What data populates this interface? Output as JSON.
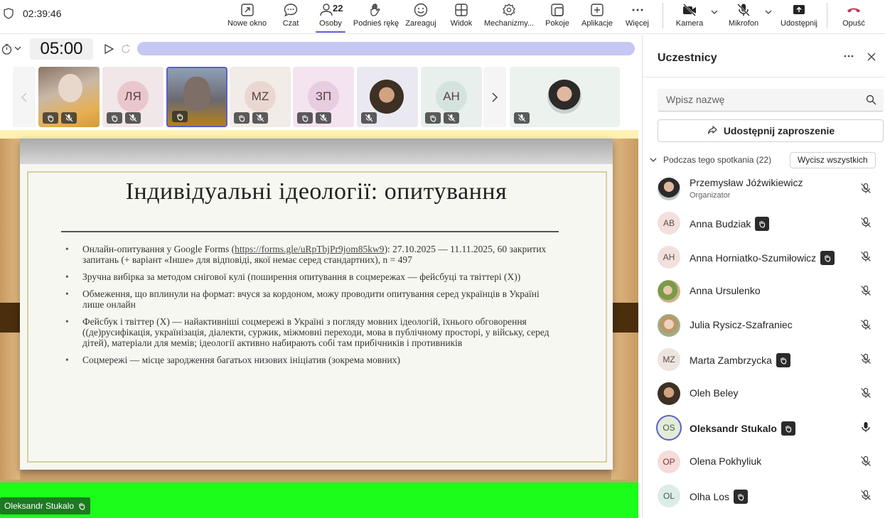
{
  "clock": "02:39:46",
  "toolbar": {
    "items": [
      {
        "label": "Nowe okno",
        "icon": "pop-out-icon"
      },
      {
        "label": "Czat",
        "icon": "chat-icon"
      },
      {
        "label": "Osoby",
        "icon": "people-icon",
        "count": "22"
      },
      {
        "label": "Podnieś rękę",
        "icon": "raise-hand-icon"
      },
      {
        "label": "Zareaguj",
        "icon": "react-icon"
      },
      {
        "label": "Widok",
        "icon": "view-icon"
      },
      {
        "label": "Mechanizmy...",
        "icon": "apps-gear-icon"
      },
      {
        "label": "Pokoje",
        "icon": "rooms-icon"
      },
      {
        "label": "Aplikacje",
        "icon": "add-app-icon"
      },
      {
        "label": "Więcej",
        "icon": "more-icon"
      },
      {
        "label": "Kamera",
        "icon": "camera-off-icon"
      },
      {
        "label": "Mikrofon",
        "icon": "mic-off-icon"
      },
      {
        "label": "Udostępnij",
        "icon": "share-icon"
      },
      {
        "label": "Opuść",
        "icon": "hang-up-icon"
      }
    ]
  },
  "timer": {
    "value": "05:00"
  },
  "strip": {
    "tiles": [
      {
        "initials": "",
        "type": "video"
      },
      {
        "initials": "ЛЯ",
        "type": "initials"
      },
      {
        "initials": "",
        "type": "video-selected"
      },
      {
        "initials": "MZ",
        "type": "initials"
      },
      {
        "initials": "ЗП",
        "type": "initials"
      },
      {
        "initials": "",
        "type": "photo"
      },
      {
        "initials": "AH",
        "type": "initials"
      },
      {
        "initials": "",
        "type": "photo-wide"
      }
    ]
  },
  "slide": {
    "title": "Індивідуальні ідеології: опитування",
    "bullets": [
      {
        "pre": "Онлайн-опитування у Google Forms (",
        "link": "https://forms.gle/uRpTbjPr9jom85kw9",
        "post": "): 27.10.2025 — 11.11.2025, 60 закритих запитань (+ варіант «Інше» для відповіді, якої немає серед стандартних), n = 497"
      },
      {
        "pre": "Зручна вибірка за методом снігової кулі (поширення опитування в соцмережах — фейсбуці та твіттері (X))",
        "link": "",
        "post": ""
      },
      {
        "pre": "Обмеження, що вплинули на формат: вчуся за кордоном, можу проводити опитування серед українців в Україні лише онлайн",
        "link": "",
        "post": ""
      },
      {
        "pre": "Фейсбук і твіттер (X) — найактивніші соцмережі в Україні з погляду мовних ідеологій, їхнього обговорення ((де)русифікація, українізація, діалекти, суржик, міжмовні переходи, мова в публічному просторі, у війську, серед дітей), матеріали для мемів; ідеології активно набирають собі там прибічників і противників",
        "link": "",
        "post": ""
      },
      {
        "pre": "Соцмережі — місце зародження багатьох низових ініціатив (зокрема мовних)",
        "link": "",
        "post": ""
      }
    ]
  },
  "presenter": {
    "name": "Oleksandr Stukalo"
  },
  "panel": {
    "title": "Uczestnicy",
    "search_placeholder": "Wpisz nazwę",
    "share_label": "Udostępnij zaproszenie",
    "section_label": "Podczas tego spotkania (22)",
    "mute_all_label": "Wycisz wszystkich",
    "participants": [
      {
        "name": "Przemysław Jóźwikiewicz",
        "role": "Organizator",
        "initials": "",
        "avatar": "photo",
        "hand": false,
        "mic": "off",
        "bold": false
      },
      {
        "name": "Anna Budziak",
        "role": "",
        "initials": "AB",
        "avatar": "initials",
        "hand": true,
        "mic": "off",
        "bold": false
      },
      {
        "name": "Anna Horniatko-Szumiłowicz",
        "role": "",
        "initials": "AH",
        "avatar": "initials",
        "hand": true,
        "mic": "off",
        "bold": false
      },
      {
        "name": "Anna Ursulenko",
        "role": "",
        "initials": "",
        "avatar": "photo",
        "hand": false,
        "mic": "off",
        "bold": false
      },
      {
        "name": "Julia Rysicz-Szafraniec",
        "role": "",
        "initials": "",
        "avatar": "photo",
        "hand": false,
        "mic": "off",
        "bold": false
      },
      {
        "name": "Marta Zambrzycka",
        "role": "",
        "initials": "MZ",
        "avatar": "initials",
        "hand": true,
        "mic": "off",
        "bold": false
      },
      {
        "name": "Oleh Beley",
        "role": "",
        "initials": "",
        "avatar": "photo",
        "hand": false,
        "mic": "off",
        "bold": false
      },
      {
        "name": "Oleksandr Stukalo",
        "role": "",
        "initials": "OS",
        "avatar": "initials-speaking",
        "hand": true,
        "mic": "on",
        "bold": true
      },
      {
        "name": "Olena Pokhyliuk",
        "role": "",
        "initials": "OP",
        "avatar": "initials",
        "hand": false,
        "mic": "off",
        "bold": false
      },
      {
        "name": "Olha Los",
        "role": "",
        "initials": "OL",
        "avatar": "initials",
        "hand": true,
        "mic": "off",
        "bold": false
      }
    ]
  }
}
